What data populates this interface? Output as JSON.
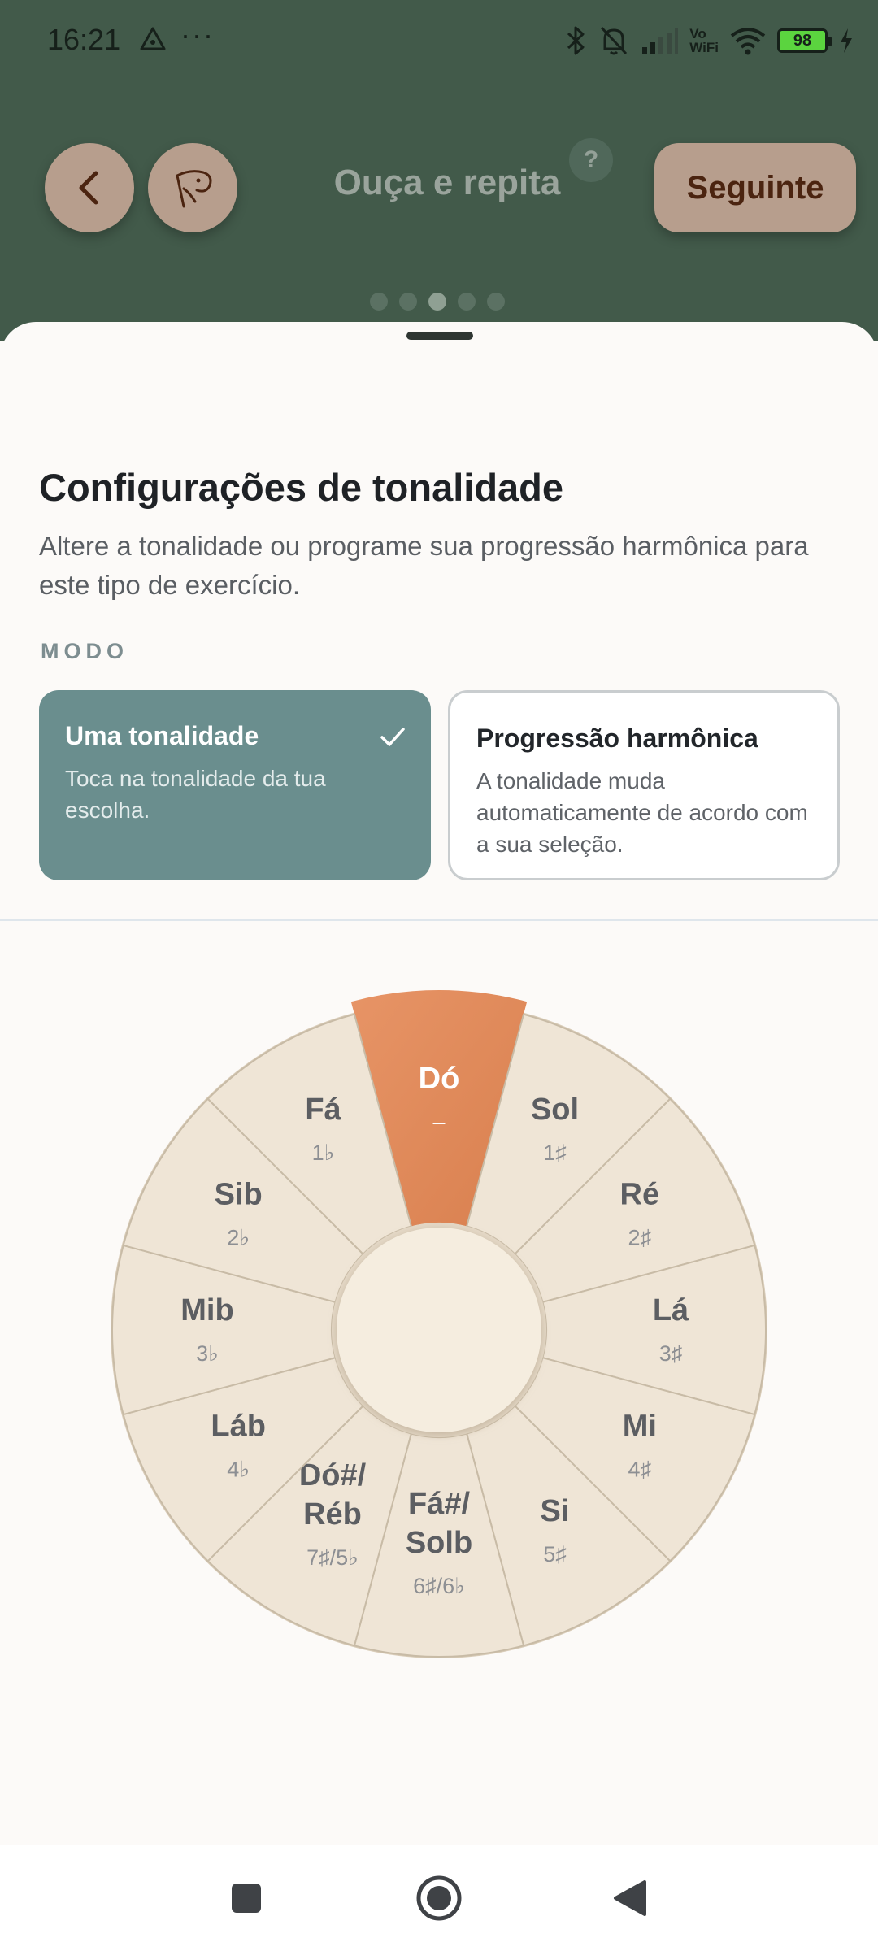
{
  "status_bar": {
    "time": "16:21",
    "more": "···",
    "network_label_top": "Vo",
    "network_label_bottom": "WiFi",
    "battery": "98"
  },
  "header": {
    "title": "Ouça e repita",
    "help": "?",
    "next_label": "Seguinte",
    "page_dots": 5,
    "active_dot": 3
  },
  "sheet": {
    "title": "Configurações de tonalidade",
    "description": "Altere a tonalidade ou programe sua progressão harmônica para este tipo de exercício.",
    "mode_label": "MODO",
    "modes": [
      {
        "title": "Uma tonalidade",
        "description": "Toca na tonalidade da tua escolha.",
        "selected": true
      },
      {
        "title": "Progressão harmônica",
        "description": "A tonalidade muda automaticamente de acordo com a sua seleção.",
        "selected": false
      }
    ]
  },
  "circle_of_fifths": {
    "selected_key": "Dó",
    "keys": [
      {
        "name": [
          "Dó"
        ],
        "signature": "–",
        "selected": true
      },
      {
        "name": [
          "Sol"
        ],
        "signature": "1♯",
        "selected": false
      },
      {
        "name": [
          "Ré"
        ],
        "signature": "2♯",
        "selected": false
      },
      {
        "name": [
          "Lá"
        ],
        "signature": "3♯",
        "selected": false
      },
      {
        "name": [
          "Mi"
        ],
        "signature": "4♯",
        "selected": false
      },
      {
        "name": [
          "Si"
        ],
        "signature": "5♯",
        "selected": false
      },
      {
        "name": [
          "Fá#/",
          "Solb"
        ],
        "signature": "6♯/6♭",
        "selected": false
      },
      {
        "name": [
          "Dó#/",
          "Réb"
        ],
        "signature": "7♯/5♭",
        "selected": false
      },
      {
        "name": [
          "Láb"
        ],
        "signature": "4♭",
        "selected": false
      },
      {
        "name": [
          "Mib"
        ],
        "signature": "3♭",
        "selected": false
      },
      {
        "name": [
          "Sib"
        ],
        "signature": "2♭",
        "selected": false
      },
      {
        "name": [
          "Fá"
        ],
        "signature": "1♭",
        "selected": false
      }
    ]
  },
  "colors": {
    "header_bg": "#425a4a",
    "selected_mode_bg": "#6a8e8e",
    "selected_key": "#e08a5a",
    "wheel_segment": "#efe5d6"
  },
  "icons": {
    "back": "chevron-left-icon",
    "profile": "conductor-icon",
    "check": "check-icon",
    "nav_square": "recents-icon",
    "nav_home": "home-icon",
    "nav_back": "back-triangle-icon"
  }
}
